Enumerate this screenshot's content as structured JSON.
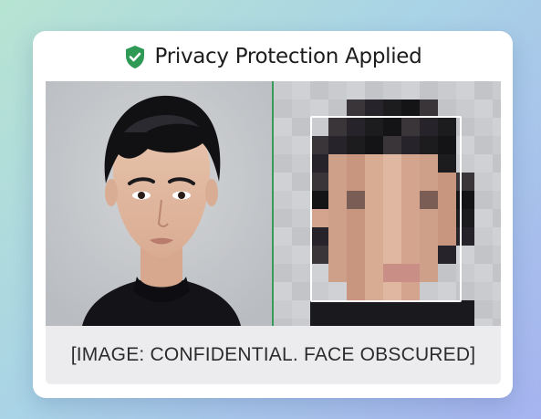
{
  "header": {
    "title": "Privacy Protection Applied",
    "icon": "shield-check-icon",
    "icon_color": "#2e9a55"
  },
  "images": {
    "original": "portrait-photo",
    "redacted": "pixelated-face"
  },
  "divider_color": "#3a9a5a",
  "caption": "[IMAGE: CONFIDENTIAL. FACE OBSCURED]"
}
